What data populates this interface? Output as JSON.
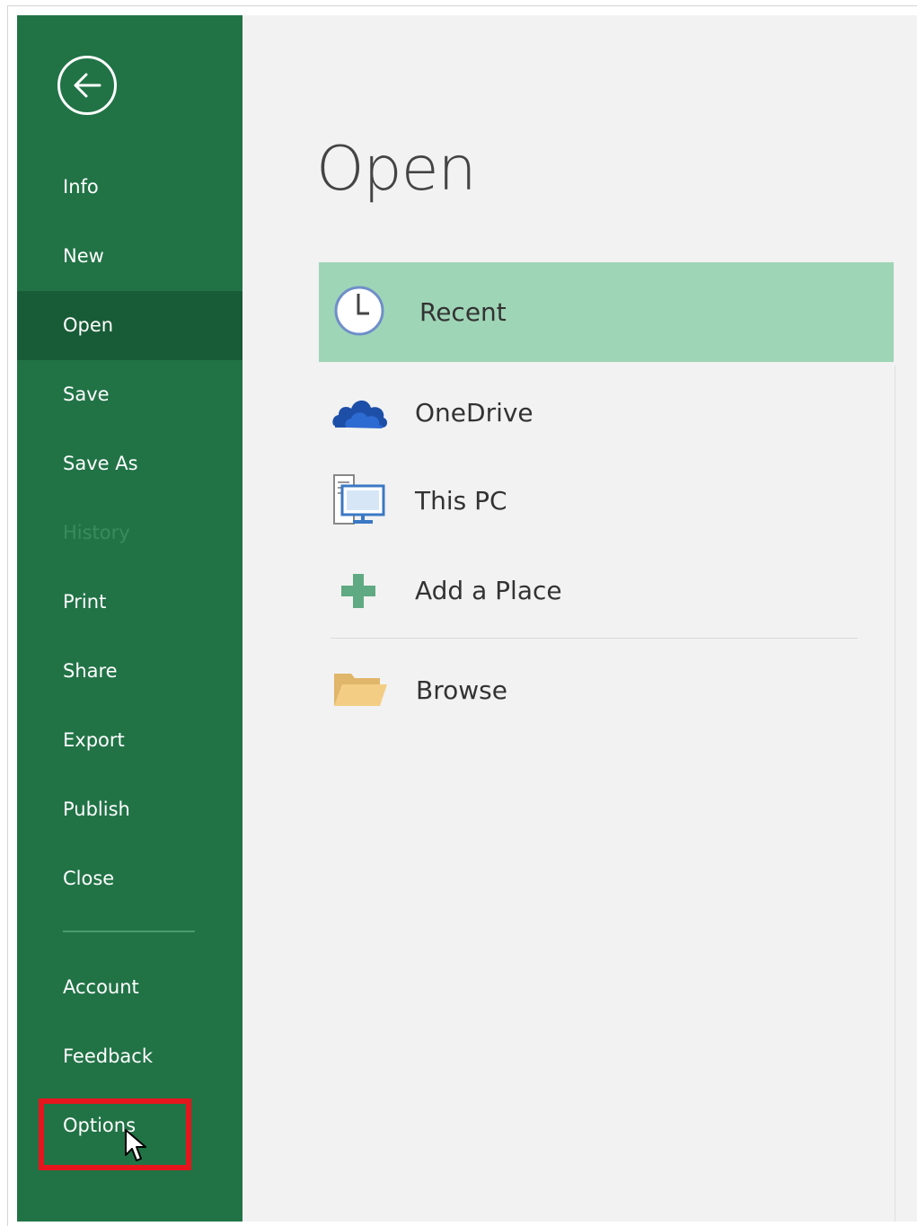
{
  "sidebar": {
    "back_icon": "back-arrow-icon",
    "items": [
      {
        "label": "Info"
      },
      {
        "label": "New"
      },
      {
        "label": "Open"
      },
      {
        "label": "Save"
      },
      {
        "label": "Save As"
      },
      {
        "label": "History"
      },
      {
        "label": "Print"
      },
      {
        "label": "Share"
      },
      {
        "label": "Export"
      },
      {
        "label": "Publish"
      },
      {
        "label": "Close"
      },
      {
        "label": "Account"
      },
      {
        "label": "Feedback"
      },
      {
        "label": "Options"
      }
    ],
    "selected": "Open",
    "disabled": [
      "History"
    ],
    "highlighted": "Options"
  },
  "main": {
    "title": "Open",
    "locations": [
      {
        "label": "Recent",
        "icon": "clock-icon"
      },
      {
        "label": "OneDrive",
        "icon": "cloud-icon"
      },
      {
        "label": "This PC",
        "icon": "computer-icon"
      },
      {
        "label": "Add a Place",
        "icon": "plus-icon"
      },
      {
        "label": "Browse",
        "icon": "folder-icon"
      }
    ]
  },
  "colors": {
    "sidebar_bg": "#217346",
    "sidebar_selected": "#185c37",
    "main_bg": "#f2f2f2",
    "location_selected": "#9fd5b7",
    "highlight_box": "#e6151d"
  }
}
